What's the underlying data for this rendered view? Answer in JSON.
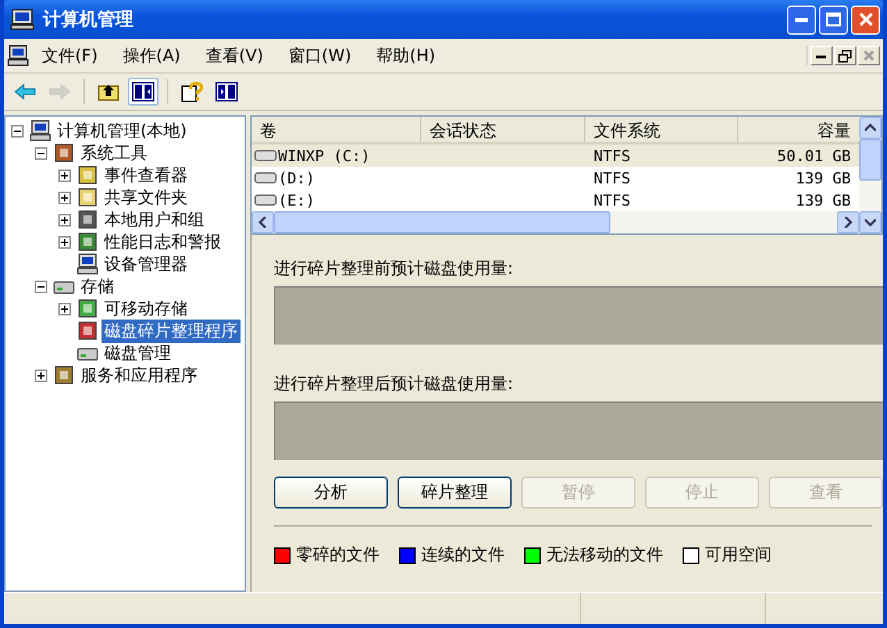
{
  "window": {
    "title": "计算机管理"
  },
  "menu": [
    {
      "label": "文件(F)"
    },
    {
      "label": "操作(A)"
    },
    {
      "label": "查看(V)"
    },
    {
      "label": "窗口(W)"
    },
    {
      "label": "帮助(H)"
    }
  ],
  "toolbar": [
    {
      "kind": "back",
      "disabled": false,
      "selected": false
    },
    {
      "kind": "forward",
      "disabled": true,
      "selected": false
    },
    {
      "kind": "up",
      "disabled": false,
      "selected": false
    },
    {
      "kind": "tree",
      "disabled": false,
      "selected": true
    },
    {
      "kind": "help",
      "disabled": false,
      "selected": false
    },
    {
      "kind": "panel",
      "disabled": false,
      "selected": false
    }
  ],
  "tree": [
    {
      "label": "计算机管理(本地)",
      "kind": "computer",
      "expanded": true,
      "selected": false,
      "children": [
        {
          "label": "系统工具",
          "kind": "tools",
          "expanded": true,
          "selected": false,
          "children": [
            {
              "label": "事件查看器",
              "kind": "log",
              "expanded": false,
              "selected": false
            },
            {
              "label": "共享文件夹",
              "kind": "folder",
              "expanded": false,
              "selected": false
            },
            {
              "label": "本地用户和组",
              "kind": "users",
              "expanded": false,
              "selected": false
            },
            {
              "label": "性能日志和警报",
              "kind": "chart",
              "expanded": false,
              "selected": false
            },
            {
              "label": "设备管理器",
              "kind": "computer",
              "selected": false
            }
          ]
        },
        {
          "label": "存储",
          "kind": "drive",
          "expanded": true,
          "selected": false,
          "children": [
            {
              "label": "可移动存储",
              "kind": "disc",
              "expanded": false,
              "selected": false
            },
            {
              "label": "磁盘碎片整理程序",
              "kind": "defrag",
              "selected": true
            },
            {
              "label": "磁盘管理",
              "kind": "drive",
              "selected": false
            }
          ]
        },
        {
          "label": "服务和应用程序",
          "kind": "services",
          "expanded": false,
          "selected": false
        }
      ]
    }
  ],
  "volumes": {
    "columns": [
      "卷",
      "会话状态",
      "文件系统",
      "容量"
    ],
    "rows": [
      {
        "volume": "WINXP (C:)",
        "file_system": "NTFS",
        "capacity": "50.01 GB",
        "selected": true
      },
      {
        "volume": "(D:)",
        "file_system": "NTFS",
        "capacity": "139 GB",
        "selected": false
      },
      {
        "volume": "(E:)",
        "file_system": "NTFS",
        "capacity": "139 GB",
        "selected": false
      }
    ]
  },
  "usage": [
    {
      "label": "进行碎片整理前预计磁盘使用量:"
    },
    {
      "label": "进行碎片整理后预计磁盘使用量:"
    }
  ],
  "buttons": [
    {
      "label": "分析",
      "disabled": false
    },
    {
      "label": "碎片整理",
      "disabled": false
    },
    {
      "label": "暂停",
      "disabled": true
    },
    {
      "label": "停止",
      "disabled": true
    },
    {
      "label": "查看",
      "disabled": true
    }
  ],
  "legend": [
    {
      "label": "零碎的文件",
      "color": "#ff0000"
    },
    {
      "label": "连续的文件",
      "color": "#0000ff"
    },
    {
      "label": "无法移动的文件",
      "color": "#00ff00"
    },
    {
      "label": "可用空间",
      "color": "#ffffff"
    }
  ]
}
